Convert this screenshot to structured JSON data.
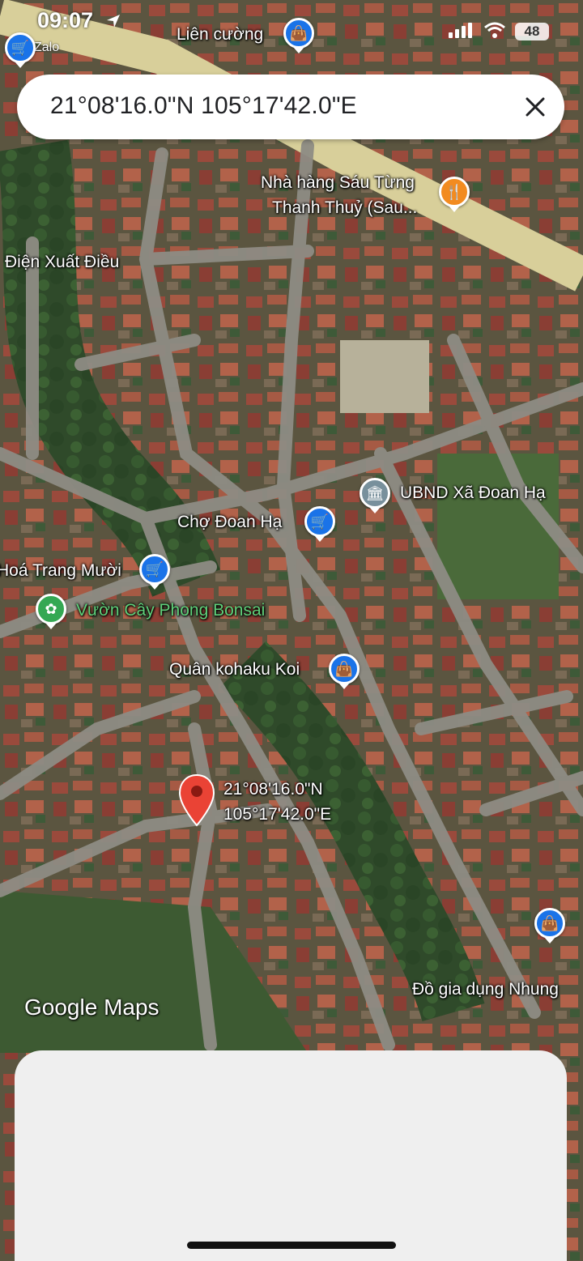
{
  "status_bar": {
    "time": "09:07",
    "back_app": "Zalo",
    "battery": "48"
  },
  "search": {
    "query": "21°08'16.0\"N 105°17'42.0\"E",
    "close_icon": "close-icon"
  },
  "marker": {
    "line1": "21°08'16.0\"N",
    "line2": "105°17'42.0\"E",
    "color": "#ea4335"
  },
  "places": [
    {
      "name": "Liên cường",
      "icon": "shopping-bag-icon"
    },
    {
      "name": "Nhà hàng Sáu Từng",
      "name2": "Thanh Thuỷ (Sau...",
      "icon": "restaurant-icon"
    },
    {
      "name": "Điện Xuất Điều"
    },
    {
      "name": "UBND Xã Đoan Hạ",
      "icon": "government-icon"
    },
    {
      "name": "Chợ Đoan Hạ",
      "icon": "cart-icon"
    },
    {
      "name": "Hoá Trang Mười",
      "icon": "cart-icon"
    },
    {
      "name": "Vườn Cây Phong Bonsai",
      "icon": "flower-icon"
    },
    {
      "name": "Quân kohaku Koi",
      "icon": "shopping-bag-icon"
    },
    {
      "name": "Đồ gia dụng Nhung"
    }
  ],
  "logo": "Google Maps",
  "colors": {
    "accent_blue": "#1a73e8",
    "restaurant_orange": "#f28b20",
    "park_green": "#34a853",
    "pin_red": "#ea4335"
  }
}
